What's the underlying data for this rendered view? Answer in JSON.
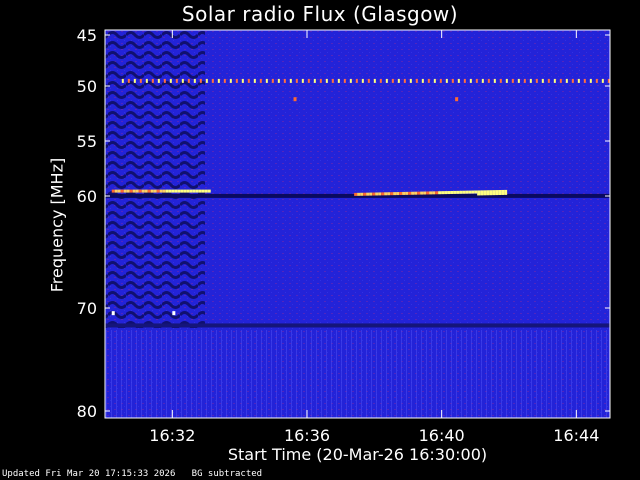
{
  "chart_data": {
    "type": "heatmap",
    "title": "Solar radio Flux (Glasgow)",
    "xlabel": "Start Time (20-Mar-26 16:30:00)",
    "ylabel": "Frequency [MHz]",
    "x_ticks": [
      "16:32",
      "16:36",
      "16:40",
      "16:44"
    ],
    "x_tick_minutes": [
      2,
      6,
      10,
      14
    ],
    "xlim_minutes": [
      0,
      15
    ],
    "y_ticks": [
      45,
      50,
      55,
      60,
      70,
      80
    ],
    "ylim": [
      45,
      80
    ],
    "y_scale": "nonlinear (reciprocal-like)",
    "grid": false,
    "colors": {
      "background": "#2323d8",
      "emission_low": "#cc2222",
      "emission_high": "#ffff80"
    },
    "features": [
      {
        "name": "interference band",
        "freq_mhz": 49.5,
        "start_min": 0.5,
        "end_min": 15
      },
      {
        "name": "emission",
        "freq_mhz": 59.6,
        "start_min": 0.2,
        "end_min": 3.2
      },
      {
        "name": "emission",
        "freq_mhz": 59.9,
        "start_min": 7.4,
        "end_min": 12.0
      }
    ]
  },
  "footer": {
    "updated": "Updated Fri Mar 20 17:15:33 2026",
    "note": "BG subtracted"
  }
}
